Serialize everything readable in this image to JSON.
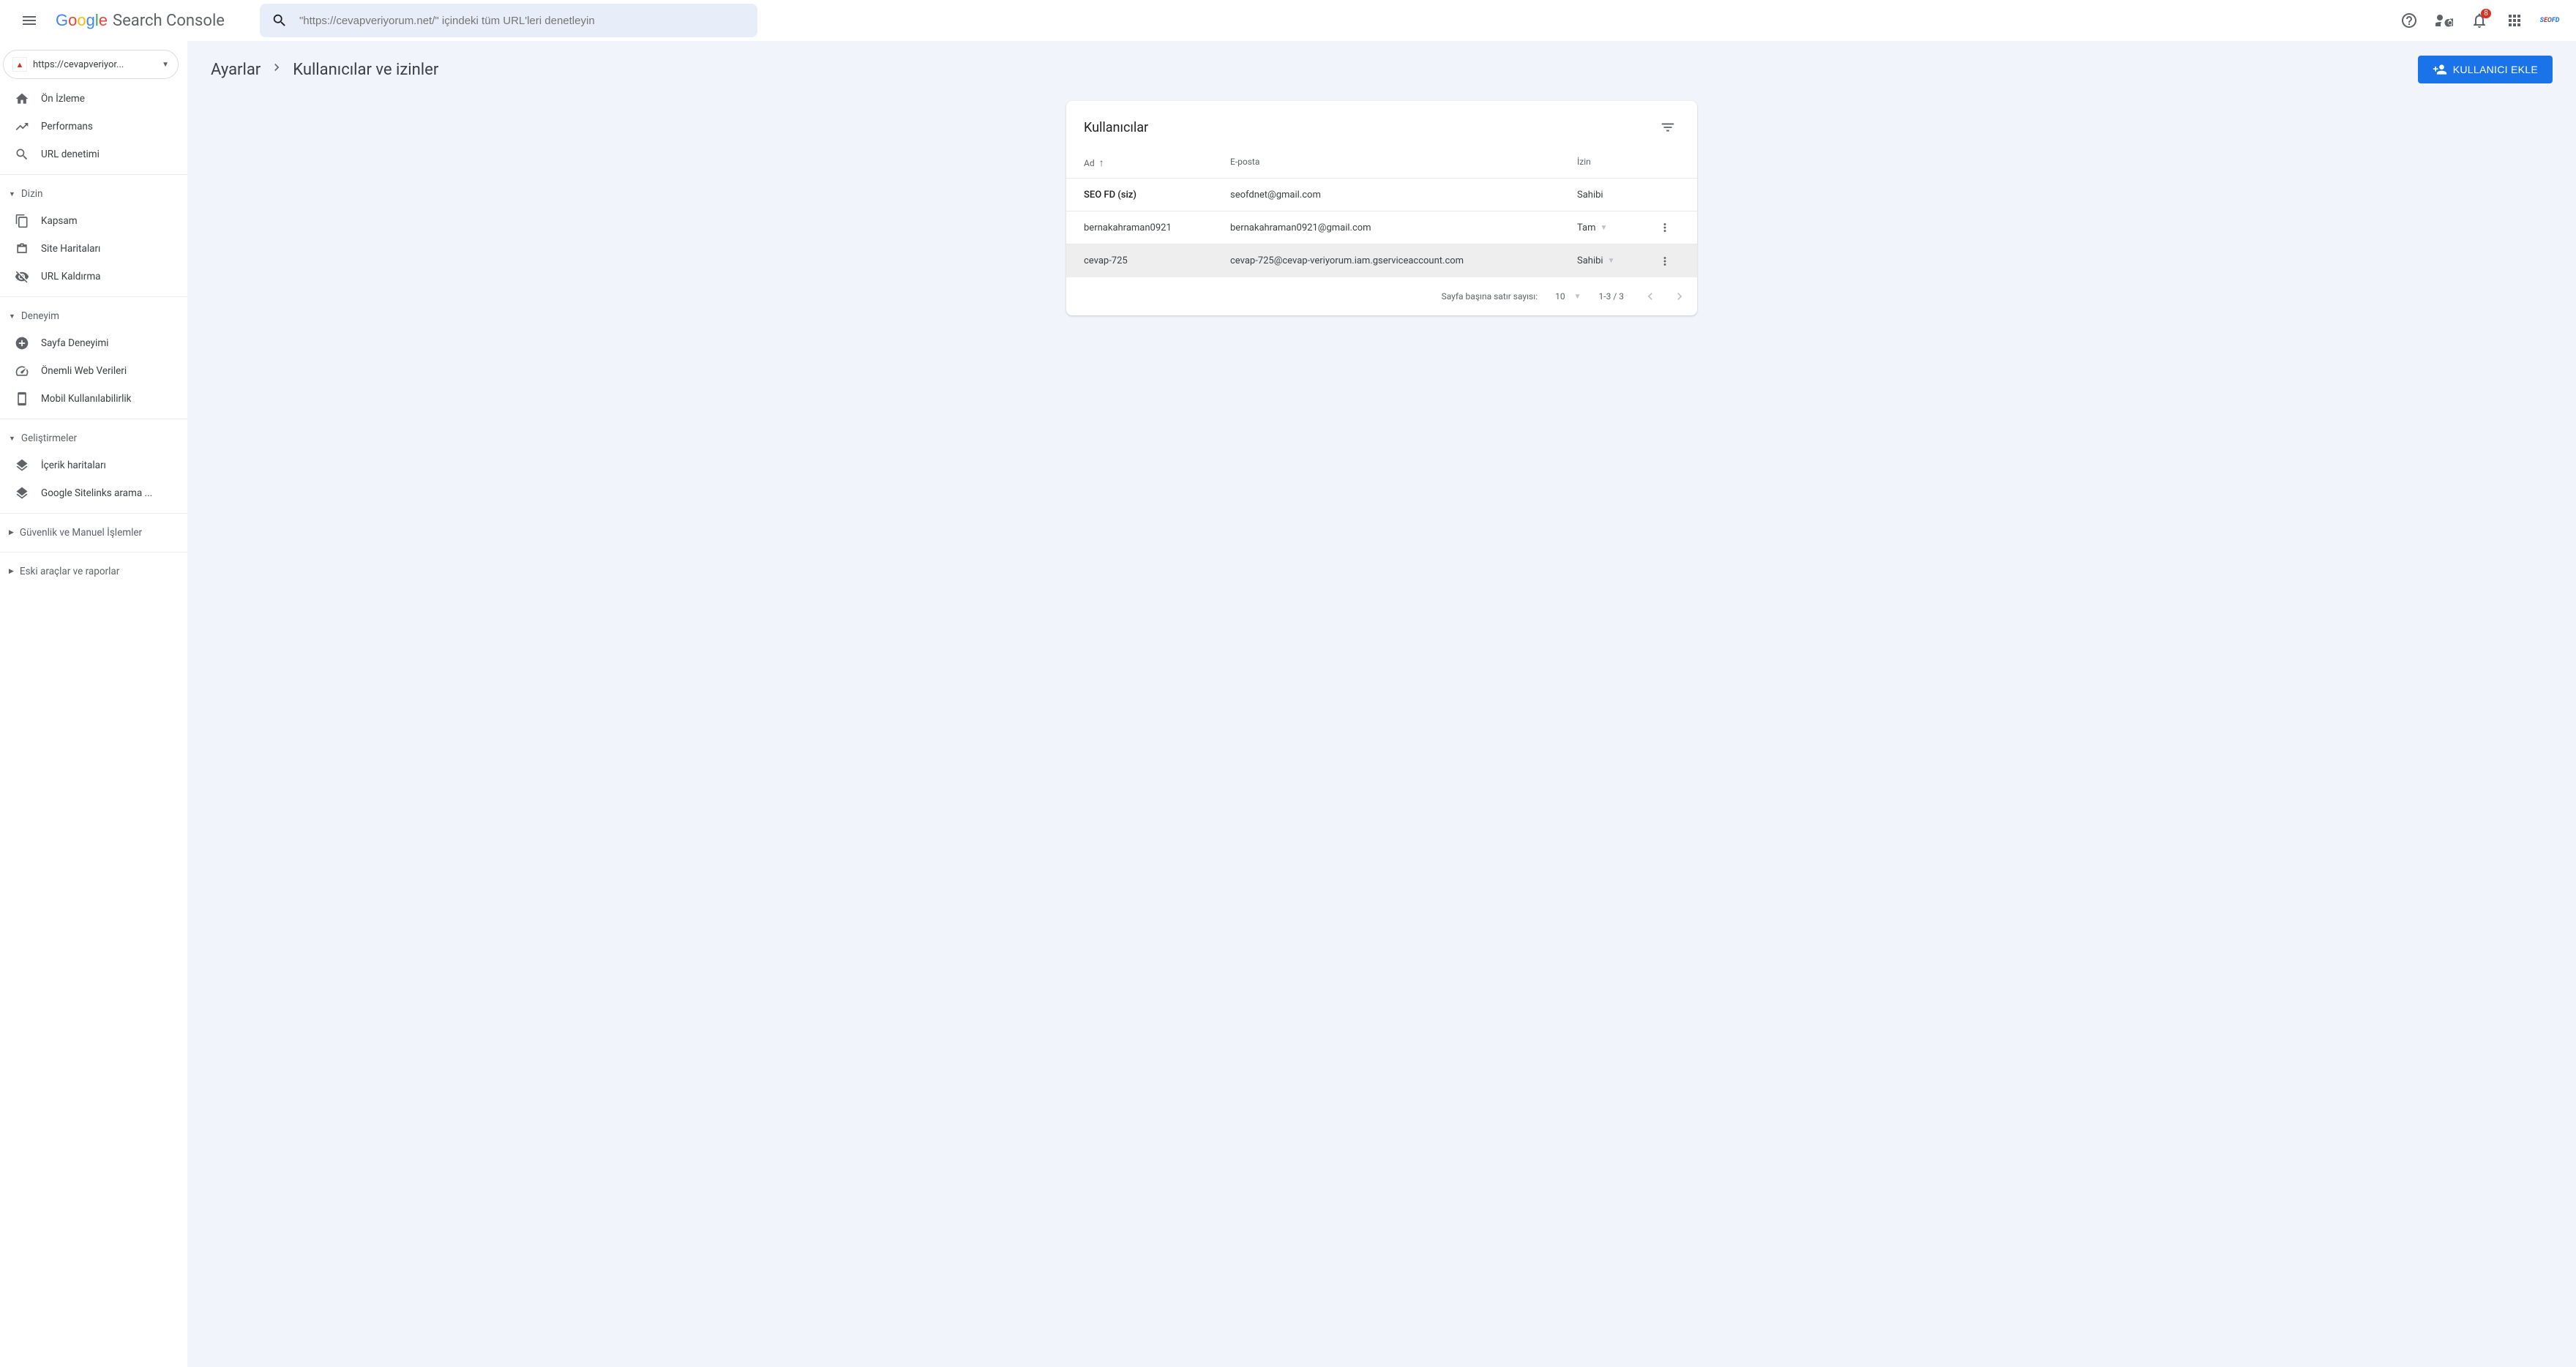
{
  "header": {
    "logo_text": "Search Console",
    "search_placeholder": "\"https://cevapveriyorum.net/\" içindeki tüm URL'leri denetleyin",
    "notification_count": "8"
  },
  "sidebar": {
    "property": "https://cevapveriyor...",
    "items": [
      {
        "label": "Ön İzleme"
      },
      {
        "label": "Performans"
      },
      {
        "label": "URL denetimi"
      }
    ],
    "groups": [
      {
        "label": "Dizin",
        "expanded": true,
        "items": [
          {
            "label": "Kapsam"
          },
          {
            "label": "Site Haritaları"
          },
          {
            "label": "URL Kaldırma"
          }
        ]
      },
      {
        "label": "Deneyim",
        "expanded": true,
        "items": [
          {
            "label": "Sayfa Deneyimi"
          },
          {
            "label": "Önemli Web Verileri"
          },
          {
            "label": "Mobil Kullanılabilirlik"
          }
        ]
      },
      {
        "label": "Geliştirmeler",
        "expanded": true,
        "items": [
          {
            "label": "İçerik haritaları"
          },
          {
            "label": "Google Sitelinks arama ..."
          }
        ]
      },
      {
        "label": "Güvenlik ve Manuel İşlemler",
        "expanded": false,
        "items": []
      },
      {
        "label": "Eski araçlar ve raporlar",
        "expanded": false,
        "items": []
      }
    ]
  },
  "breadcrumb": {
    "parent": "Ayarlar",
    "current": "Kullanıcılar ve izinler"
  },
  "add_user_label": "KULLANICI EKLE",
  "card": {
    "title": "Kullanıcılar",
    "columns": {
      "name": "Ad",
      "email": "E-posta",
      "permission": "İzin"
    },
    "rows": [
      {
        "name": "SEO FD (siz)",
        "email": "seofdnet@gmail.com",
        "permission": "Sahibi",
        "bold": true,
        "has_dropdown": false,
        "has_menu": false
      },
      {
        "name": "bernakahraman0921",
        "email": "bernakahraman0921@gmail.com",
        "permission": "Tam",
        "bold": false,
        "has_dropdown": true,
        "has_menu": true
      },
      {
        "name": "cevap-725",
        "email": "cevap-725@cevap-veriyorum.iam.gserviceaccount.com",
        "permission": "Sahibi",
        "bold": false,
        "has_dropdown": true,
        "has_menu": true,
        "hovered": true
      }
    ],
    "footer": {
      "rows_per_page_label": "Sayfa başına satır sayısı:",
      "rows_per_page_value": "10",
      "range": "1-3 / 3"
    }
  }
}
